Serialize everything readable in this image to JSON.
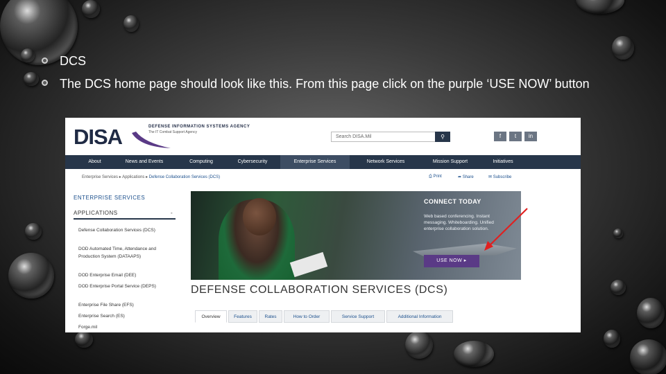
{
  "slide": {
    "heading": "DCS",
    "body": "The DCS home page should look like this. From this page click on the purple ‘USE NOW’ button"
  },
  "site": {
    "logo": "DISA",
    "agency_line1": "DEFENSE INFORMATION SYSTEMS AGENCY",
    "agency_line2": "The IT Combat Support Agency",
    "search_placeholder": "Search DISA.Mil",
    "social": [
      "f",
      "t",
      "in"
    ],
    "nav": [
      "About",
      "News and Events",
      "Computing",
      "Cybersecurity",
      "Enterprise Services",
      "Network Services",
      "Mission Support",
      "Initiatives"
    ],
    "nav_active": "Enterprise Services",
    "breadcrumb": [
      "Enterprise Services",
      "Applications",
      "Defense Collaboration Services (DCS)"
    ],
    "tools": [
      "Print",
      "Share",
      "Subscribe"
    ],
    "sidebar": {
      "title": "ENTERPRISE SERVICES",
      "subtitle": "APPLICATIONS",
      "collapse": "-",
      "items": [
        "Defense Collaboration Services (DCS)",
        "DOD Automated Time, Attendance and Production System (DATAAPS)",
        "DOD Enterprise Email (DEE)",
        "DOD Enterprise Portal Service (DEPS)",
        "Enterprise File Share (EFS)",
        "Enterprise Search (ES)",
        "Forge.mil"
      ]
    },
    "hero": {
      "title": "CONNECT TODAY",
      "description": "Web based conferencing. Instant messaging. Whiteboarding. Unified enterprise collaboration solution.",
      "button": "USE NOW"
    },
    "page_title": "DEFENSE COLLABORATION SERVICES (DCS)",
    "tabs": [
      "Overview",
      "Features",
      "Rates",
      "How to Order",
      "Service Support",
      "Additional Information"
    ],
    "active_tab": "Overview"
  },
  "colors": {
    "nav_bg": "#27364a",
    "use_now": "#5a3a86",
    "annotation_arrow": "#e02020",
    "link": "#1b4f8c"
  }
}
